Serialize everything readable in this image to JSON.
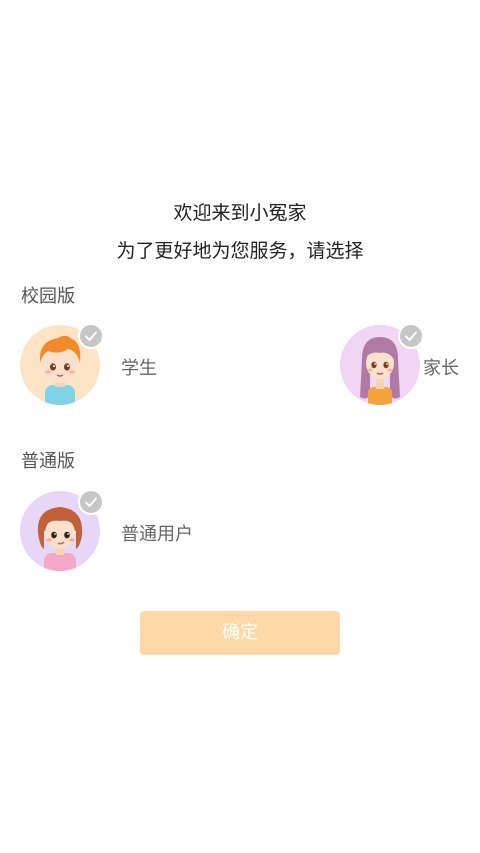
{
  "header": {
    "welcome_line1": "欢迎来到小冤家",
    "welcome_line2": "为了更好地为您服务，请选择"
  },
  "sections": {
    "campus": {
      "title": "校园版",
      "roles": [
        {
          "label": "学生",
          "icon": "boy-avatar-icon",
          "avatar_bg": "#fde4c6"
        },
        {
          "label": "家长",
          "icon": "girl-avatar-icon",
          "avatar_bg": "#f2d4f4"
        }
      ]
    },
    "general": {
      "title": "普通版",
      "roles": [
        {
          "label": "普通用户",
          "icon": "user-avatar-icon",
          "avatar_bg": "#e6d6f8"
        }
      ]
    }
  },
  "confirm": {
    "label": "确定",
    "color": "#ffd8a8"
  },
  "check_icon_color": "#c6c6c6"
}
